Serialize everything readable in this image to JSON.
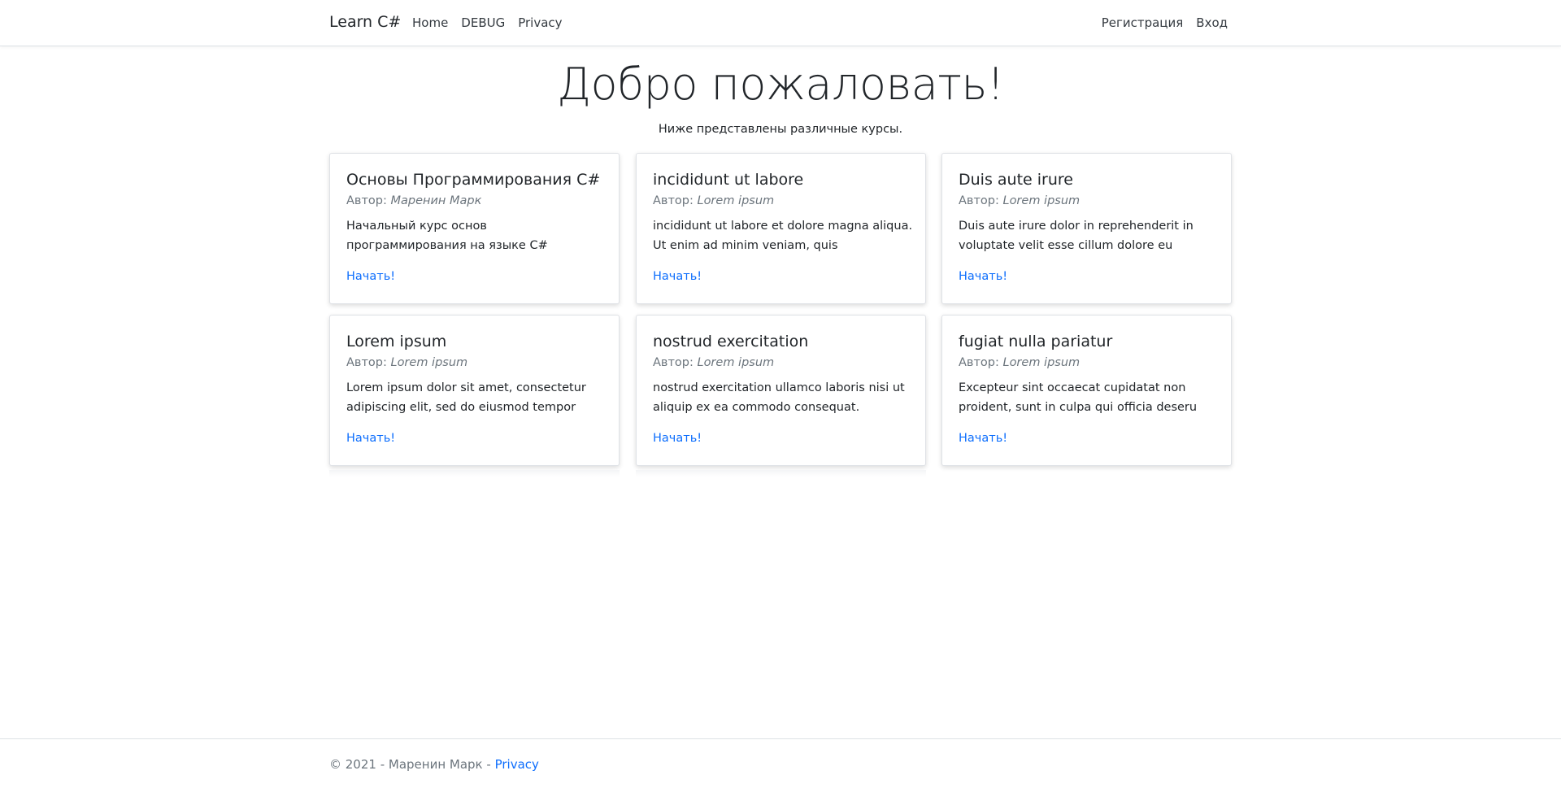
{
  "navbar": {
    "brand": "Learn C#",
    "left_links": [
      "Home",
      "DEBUG",
      "Privacy"
    ],
    "right_links": [
      "Регистрация",
      "Вход"
    ]
  },
  "hero": {
    "title": "Добро пожаловать!",
    "subtitle": "Ниже представлены различные курсы."
  },
  "author_prefix": "Автор: ",
  "start_label": "Начать!",
  "courses": [
    {
      "title": "Основы Программирования C#",
      "author": "Маренин Марк",
      "description": "Начальный курс основ программирования на языке C#"
    },
    {
      "title": "incididunt ut labore",
      "author": "Lorem ipsum",
      "description": "incididunt ut labore et dolore magna aliqua. Ut enim ad minim veniam, quis"
    },
    {
      "title": "Duis aute irure",
      "author": "Lorem ipsum",
      "description": "Duis aute irure dolor in reprehenderit in voluptate velit esse cillum dolore eu"
    },
    {
      "title": "Lorem ipsum",
      "author": "Lorem ipsum",
      "description": "Lorem ipsum dolor sit amet, consectetur adipiscing elit, sed do eiusmod tempor"
    },
    {
      "title": "nostrud exercitation",
      "author": "Lorem ipsum",
      "description": "nostrud exercitation ullamco laboris nisi ut aliquip ex ea commodo consequat."
    },
    {
      "title": "fugiat nulla pariatur",
      "author": "Lorem ipsum",
      "description": "Excepteur sint occaecat cupidatat non proident, sunt in culpa qui officia deseru"
    }
  ],
  "footer": {
    "text": "© 2021 - Маренин Марк - ",
    "link": "Privacy"
  },
  "colors": {
    "link": "#0d6efd",
    "muted": "#6c757d",
    "text": "#212529"
  }
}
